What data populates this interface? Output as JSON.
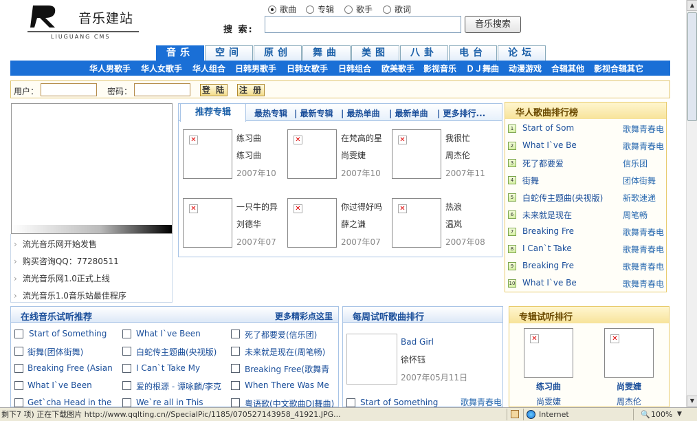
{
  "logo": {
    "title": "音乐建站",
    "subtitle": "LIUGUANG CMS"
  },
  "search": {
    "types": [
      "歌曲",
      "专辑",
      "歌手",
      "歌词"
    ],
    "selected": "歌曲",
    "label": "搜 索:",
    "value": "",
    "button": "音乐搜索"
  },
  "tabs": [
    "音乐",
    "空间",
    "原创",
    "舞曲",
    "美图",
    "八卦",
    "电台",
    "论坛"
  ],
  "active_tab": "音乐",
  "nav": [
    "华人男歌手",
    "华人女歌手",
    "华人组合",
    "日韩男歌手",
    "日韩女歌手",
    "日韩组合",
    "欧美歌手",
    "影视音乐",
    "ＤＪ舞曲",
    "动漫游戏",
    "合辑其他",
    "影视合辑其它"
  ],
  "login": {
    "user_label": "用户：",
    "pass_label": "密码：",
    "login_btn": "登 陆",
    "register_btn": "注 册"
  },
  "news": [
    "流光音乐网开始发售",
    "购买咨询QQ：77280511",
    "流光音乐网1.0正式上线",
    "流光音乐1.0音乐站最佳程序"
  ],
  "recommend": {
    "title": "推荐专辑",
    "links": [
      "最热专辑",
      "| 最新专辑",
      "| 最热单曲",
      "| 最新单曲",
      "| 更多排行..."
    ],
    "albums": [
      {
        "title": "练习曲",
        "artist": "练习曲",
        "date": "2007年10"
      },
      {
        "title": "在梵高的星",
        "artist": "尚雯婕",
        "date": "2007年10"
      },
      {
        "title": "我很忙",
        "artist": "周杰伦",
        "date": "2007年11"
      },
      {
        "title": "一只牛的异",
        "artist": "刘德华",
        "date": "2007年07"
      },
      {
        "title": "你过得好吗",
        "artist": "薛之谦",
        "date": "2007年07"
      },
      {
        "title": "热浪",
        "artist": "温岚",
        "date": "2007年08"
      }
    ]
  },
  "chart": {
    "title": "华人歌曲排行榜",
    "items": [
      {
        "rank": "1",
        "song": "Start of Som",
        "artist": "歌舞青春电"
      },
      {
        "rank": "2",
        "song": "What I`ve Be",
        "artist": "歌舞青春电"
      },
      {
        "rank": "3",
        "song": "死了都要爱",
        "artist": "信乐团"
      },
      {
        "rank": "4",
        "song": "街舞",
        "artist": "团体街舞"
      },
      {
        "rank": "5",
        "song": "白蛇传主题曲(央视版)",
        "artist": "新歌速递"
      },
      {
        "rank": "6",
        "song": "未来就是现在",
        "artist": "周笔畅"
      },
      {
        "rank": "7",
        "song": "Breaking Fre",
        "artist": "歌舞青春电"
      },
      {
        "rank": "8",
        "song": "I Can`t Take",
        "artist": "歌舞青春电"
      },
      {
        "rank": "9",
        "song": "Breaking Fre",
        "artist": "歌舞青春电"
      },
      {
        "rank": "10",
        "song": "What I`ve Be",
        "artist": "歌舞青春电"
      }
    ]
  },
  "online": {
    "title": "在线音乐试听推荐",
    "more": "更多精彩点这里",
    "songs": [
      [
        "Start of Something",
        "What I`ve Been",
        "死了都要爱(信乐团)"
      ],
      [
        "街舞(团体街舞)",
        "白蛇传主题曲(央视版)",
        "未来就是现在(周笔畅)"
      ],
      [
        "Breaking Free (Asian",
        "I Can`t Take My",
        "Breaking Free(歌舞青"
      ],
      [
        "What I`ve Been",
        "爱的根源 - 谭咏麟/李克",
        "When There Was Me"
      ],
      [
        "Get`cha Head in the",
        "We`re all in This",
        "粤语歌(中文歌曲DJ舞曲)"
      ]
    ]
  },
  "weekly": {
    "title": "每周试听歌曲排行",
    "featured": {
      "song": "Bad Girl",
      "artist": "徐怀钰",
      "date": "2007年05月11日"
    },
    "list": [
      {
        "song": "Start of Something",
        "artist": "歌舞青春电"
      }
    ]
  },
  "album_chart": {
    "title": "专辑试听排行",
    "items": [
      {
        "title": "练习曲",
        "artist": "尚雯婕"
      },
      {
        "title": "尚雯婕",
        "artist": "周杰伦"
      }
    ]
  },
  "statusbar": {
    "text": "剩下7 项) 正在下载图片 http://www.qqlting.cn//SpecialPic/1185/070527143958_41921.JPG...",
    "zone": "Internet",
    "zoom": "100%"
  }
}
